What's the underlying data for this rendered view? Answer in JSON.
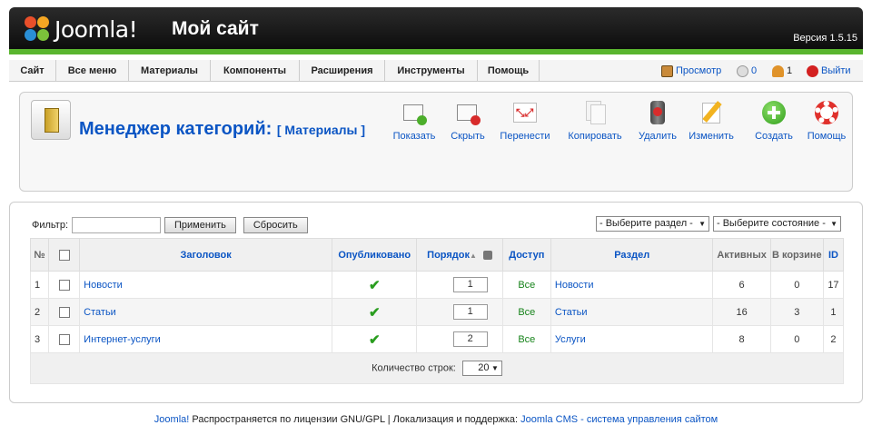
{
  "header": {
    "logo_text": "Joomla!",
    "site_name": "Мой сайт",
    "version": "Версия 1.5.15"
  },
  "menu": {
    "items": [
      {
        "label": "Сайт"
      },
      {
        "label": "Все меню"
      },
      {
        "label": "Материалы"
      },
      {
        "label": "Компоненты"
      },
      {
        "label": "Расширения"
      },
      {
        "label": "Инструменты"
      },
      {
        "label": "Помощь"
      }
    ],
    "status": {
      "preview_label": "Просмотр",
      "messages_count": "0",
      "users_count": "1",
      "logout_label": "Выйти"
    }
  },
  "toolbar": {
    "title": "Менеджер категорий:",
    "subtitle": "[ Материалы ]",
    "buttons": [
      {
        "label": "Показать",
        "icon": "publish-icon"
      },
      {
        "label": "Скрыть",
        "icon": "unpublish-icon"
      },
      {
        "label": "Перенести",
        "icon": "move-icon"
      },
      {
        "label": "Копировать",
        "icon": "copy-icon"
      },
      {
        "label": "Удалить",
        "icon": "trash-icon"
      },
      {
        "label": "Изменить",
        "icon": "edit-icon"
      },
      {
        "label": "Создать",
        "icon": "new-icon"
      },
      {
        "label": "Помощь",
        "icon": "help-icon"
      }
    ]
  },
  "filter": {
    "label": "Фильтр:",
    "value": "",
    "apply_label": "Применить",
    "reset_label": "Сбросить",
    "section_select": "- Выберите раздел -",
    "state_select": "- Выберите состояние -"
  },
  "grid": {
    "headers": {
      "num": "№",
      "title": "Заголовок",
      "published": "Опубликовано",
      "order": "Порядок",
      "access": "Доступ",
      "section": "Раздел",
      "active": "Активных",
      "trash": "В корзине",
      "id": "ID"
    },
    "rows": [
      {
        "num": "1",
        "title": "Новости",
        "order": "1",
        "access": "Все",
        "section": "Новости",
        "active": "6",
        "trash": "0",
        "id": "17"
      },
      {
        "num": "2",
        "title": "Статьи",
        "order": "1",
        "access": "Все",
        "section": "Статьи",
        "active": "16",
        "trash": "3",
        "id": "1"
      },
      {
        "num": "3",
        "title": "Интернет-услуги",
        "order": "2",
        "access": "Все",
        "section": "Услуги",
        "active": "8",
        "trash": "0",
        "id": "2"
      }
    ],
    "footer": {
      "rows_label": "Количество строк:",
      "rows_value": "20"
    }
  },
  "footer": {
    "brand": "Joomla!",
    "license_text": "Распространяется по лицензии GNU/GPL | Локализация и поддержка:",
    "support_link": "Joomla CMS - система управления сайтом"
  },
  "colors": {
    "accent_green": "#5ab52f",
    "link_blue": "#0b55c4",
    "header_dark": "#1a1a1a"
  }
}
